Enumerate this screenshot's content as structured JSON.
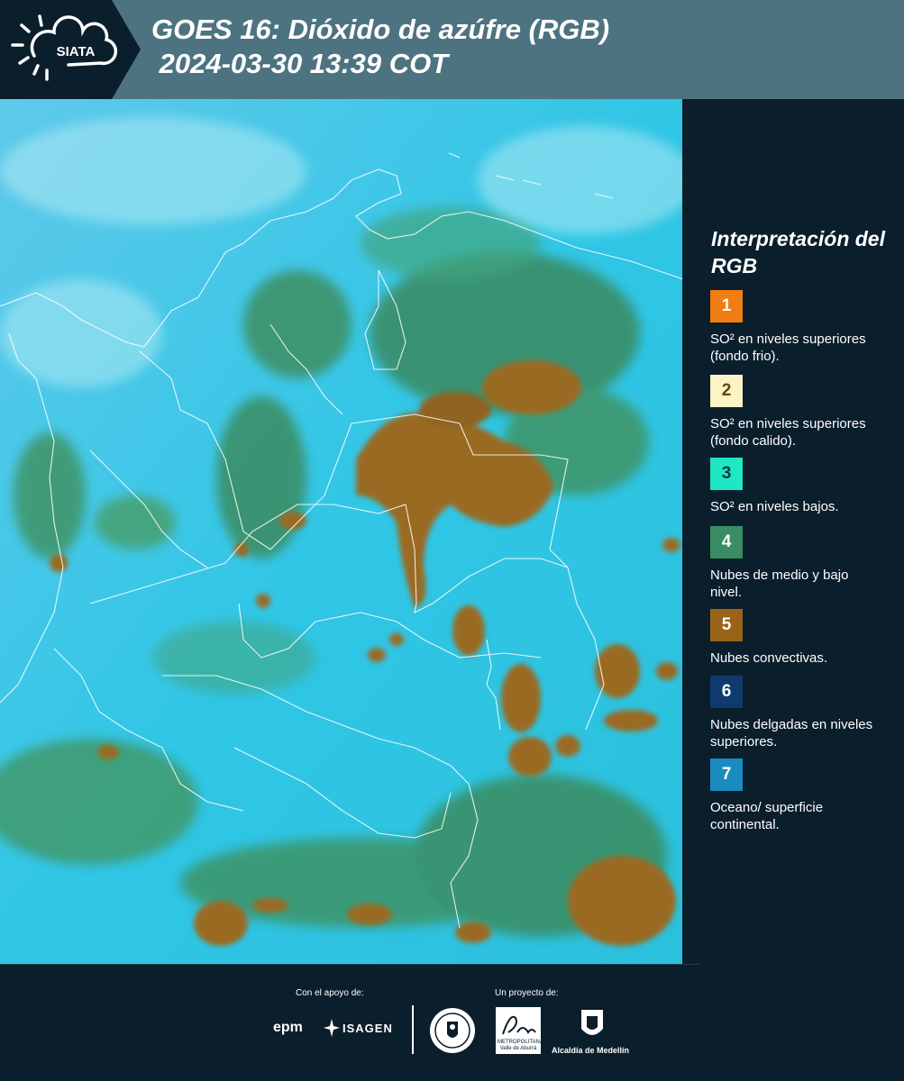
{
  "header": {
    "logo_text": "SIATA",
    "title_line1": "GOES 16: Dióxido de azúfre (RGB)",
    "title_line2": " 2024-03-30 13:39 COT",
    "bg_color": "#4d7381"
  },
  "legend": {
    "title": "Interpretación del RGB",
    "items": [
      {
        "number": "1",
        "color": "#f07d12",
        "text": "SO² en niveles superiores (fondo frio)."
      },
      {
        "number": "2",
        "color": "#fdf3c4",
        "number_color": "#5a4a10",
        "text": "SO² en niveles superiores (fondo calido)."
      },
      {
        "number": "3",
        "color": "#1ee8c4",
        "number_color": "#0b3a3a",
        "text": "SO² en niveles bajos."
      },
      {
        "number": "4",
        "color": "#3a8c64",
        "text": "Nubes de medio y bajo nivel."
      },
      {
        "number": "5",
        "color": "#9a6418",
        "text": "Nubes convectivas."
      },
      {
        "number": "6",
        "color": "#0e3a6e",
        "text": "Nubes delgadas en niveles superiores."
      },
      {
        "number": "7",
        "color": "#1a8cc0",
        "text": "Oceano/ superficie continental."
      }
    ]
  },
  "footer": {
    "support_label": "Con el apoyo de:",
    "project_label": "Un proyecto de:",
    "sponsors": [
      "epm",
      "ISAGEN"
    ],
    "metro_text": "METROPOLITANA Valle de Aburrá",
    "alcaldia_text": "Alcaldía de Medellín"
  },
  "map": {
    "ocean_color": "#33c4e4",
    "convective_color": "#9a6a22",
    "midlevel_color": "#3f9466"
  }
}
